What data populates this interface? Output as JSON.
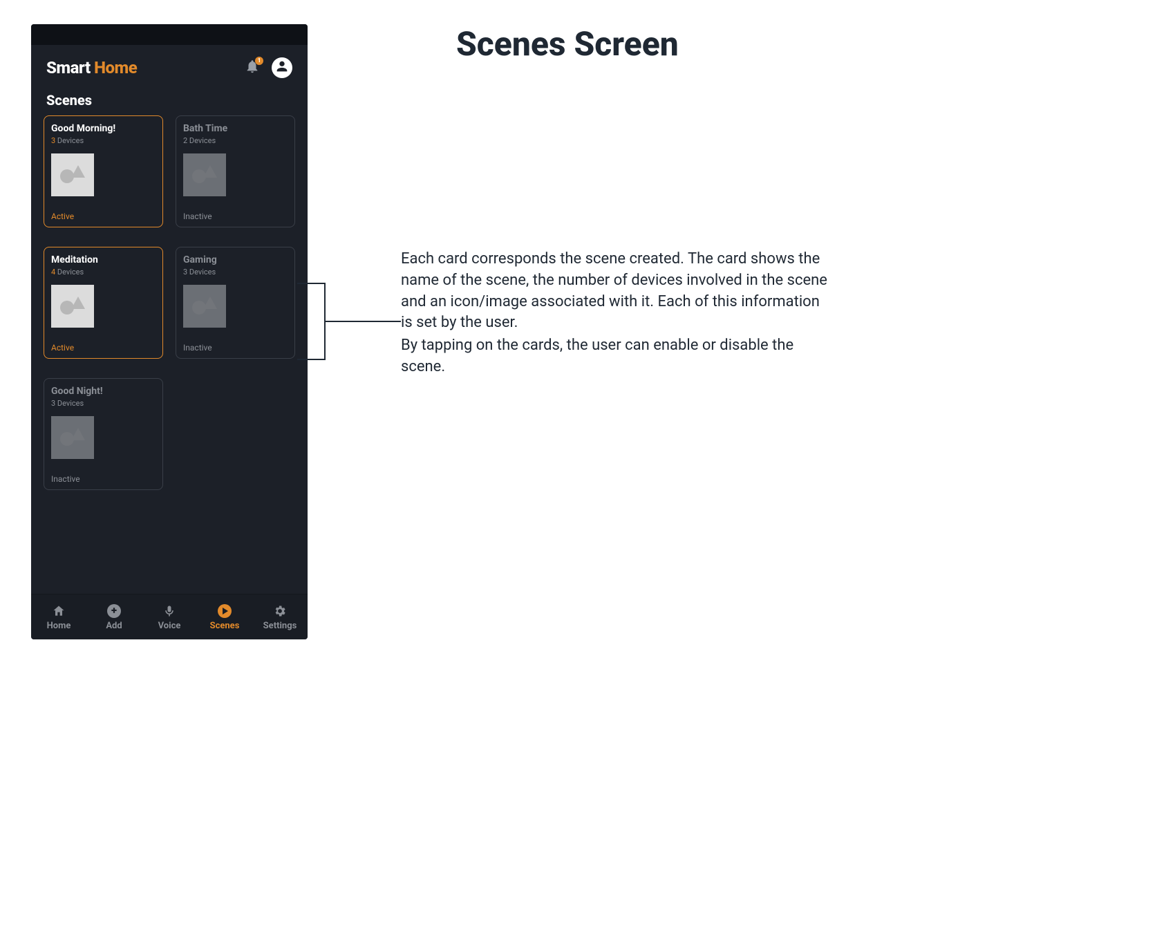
{
  "doc": {
    "title": "Scenes Screen",
    "body_p1": "Each card corresponds the scene created. The card shows the name of the scene, the number of devices involved in the scene and an icon/image associated with it. Each of this information is set by the user.",
    "body_p2": "By tapping on the cards, the user can enable or disable the scene."
  },
  "brand": {
    "word1": "Smart",
    "word2": "Home"
  },
  "header": {
    "notification_count": "1"
  },
  "section": {
    "title": "Scenes"
  },
  "scenes": [
    {
      "name": "Good Morning!",
      "device_count": "3",
      "devices_label": "Devices",
      "status": "Active",
      "active": true
    },
    {
      "name": "Bath Time",
      "device_count": "2",
      "devices_label": "Devices",
      "status": "Inactive",
      "active": false
    },
    {
      "name": "Meditation",
      "device_count": "4",
      "devices_label": "Devices",
      "status": "Active",
      "active": true
    },
    {
      "name": "Gaming",
      "device_count": "3",
      "devices_label": "Devices",
      "status": "Inactive",
      "active": false
    },
    {
      "name": "Good Night!",
      "device_count": "3",
      "devices_label": "Devices",
      "status": "Inactive",
      "active": false
    }
  ],
  "nav": {
    "home": {
      "label": "Home"
    },
    "add": {
      "label": "Add"
    },
    "voice": {
      "label": "Voice"
    },
    "scenes": {
      "label": "Scenes"
    },
    "settings": {
      "label": "Settings"
    }
  },
  "colors": {
    "accent": "#e28a2b",
    "bg_dark": "#1c2028"
  }
}
